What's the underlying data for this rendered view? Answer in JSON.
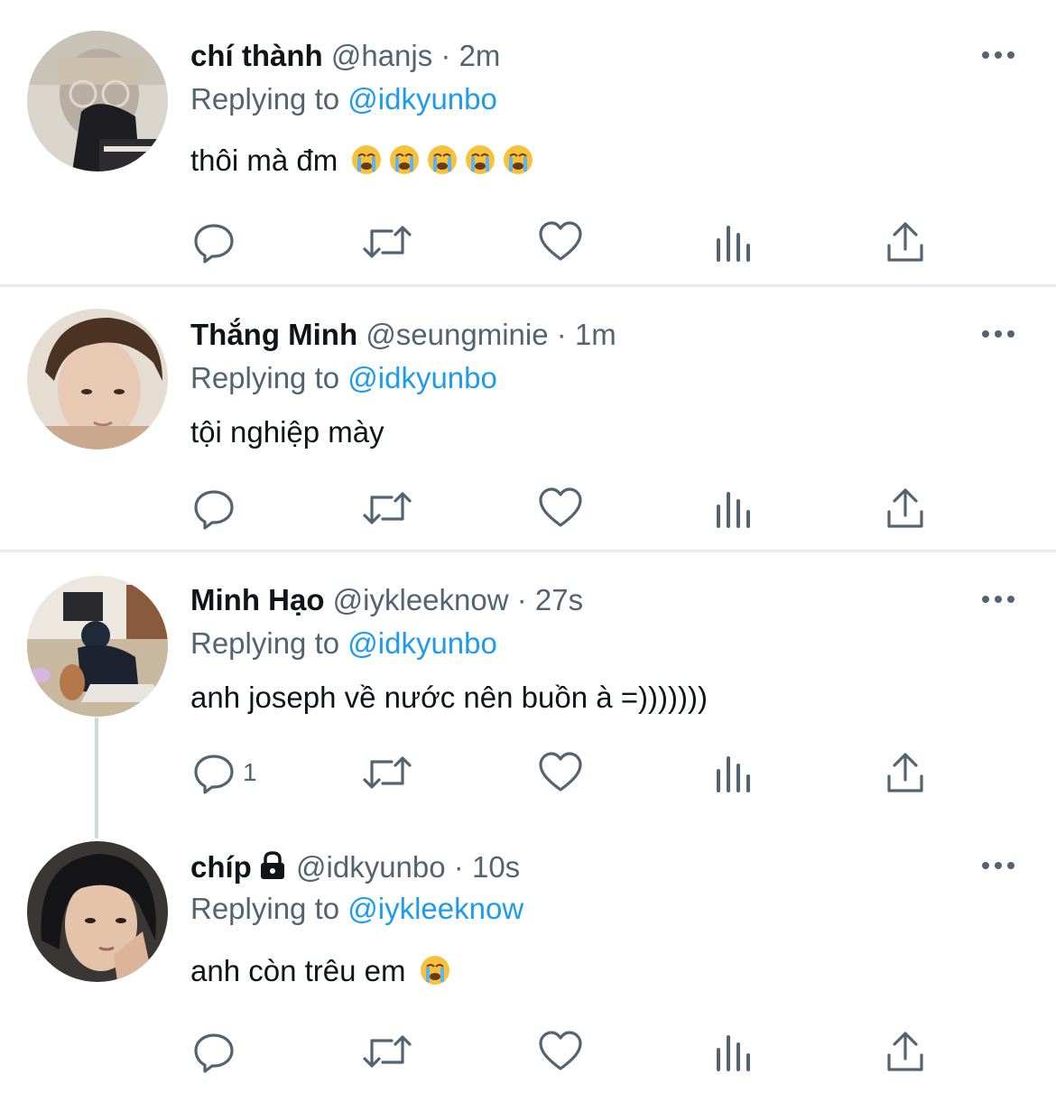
{
  "tweets": [
    {
      "name": "chí thành",
      "handle": "@hanjs",
      "sep": "·",
      "time": "2m",
      "replying_prefix": "Replying to ",
      "replying_to": "@idkyunbo",
      "text": "thôi mà đm",
      "reply_count": ""
    },
    {
      "name": "Thắng Minh",
      "handle": "@seungminie",
      "sep": "·",
      "time": "1m",
      "replying_prefix": "Replying to ",
      "replying_to": "@idkyunbo",
      "text": "tội nghiệp mày",
      "reply_count": ""
    },
    {
      "name": "Minh Hạo",
      "handle": "@iykleeknow",
      "sep": "·",
      "time": "27s",
      "replying_prefix": "Replying to ",
      "replying_to": "@idkyunbo",
      "text": "anh joseph về nước nên buồn à =)))))))",
      "reply_count": "1"
    },
    {
      "name": "chíp",
      "handle": "@idkyunbo",
      "sep": "·",
      "time": "10s",
      "replying_prefix": "Replying to ",
      "replying_to": "@iykleeknow",
      "text": "anh còn trêu em",
      "reply_count": ""
    }
  ],
  "colors": {
    "text": "#0f1419",
    "secondary": "#536471",
    "link": "#1d9bf0",
    "divider": "#e7e9ec"
  },
  "icons": [
    "reply-icon",
    "retweet-icon",
    "like-icon",
    "analytics-icon",
    "share-icon",
    "more-icon",
    "lock-icon",
    "crying-emoji"
  ]
}
